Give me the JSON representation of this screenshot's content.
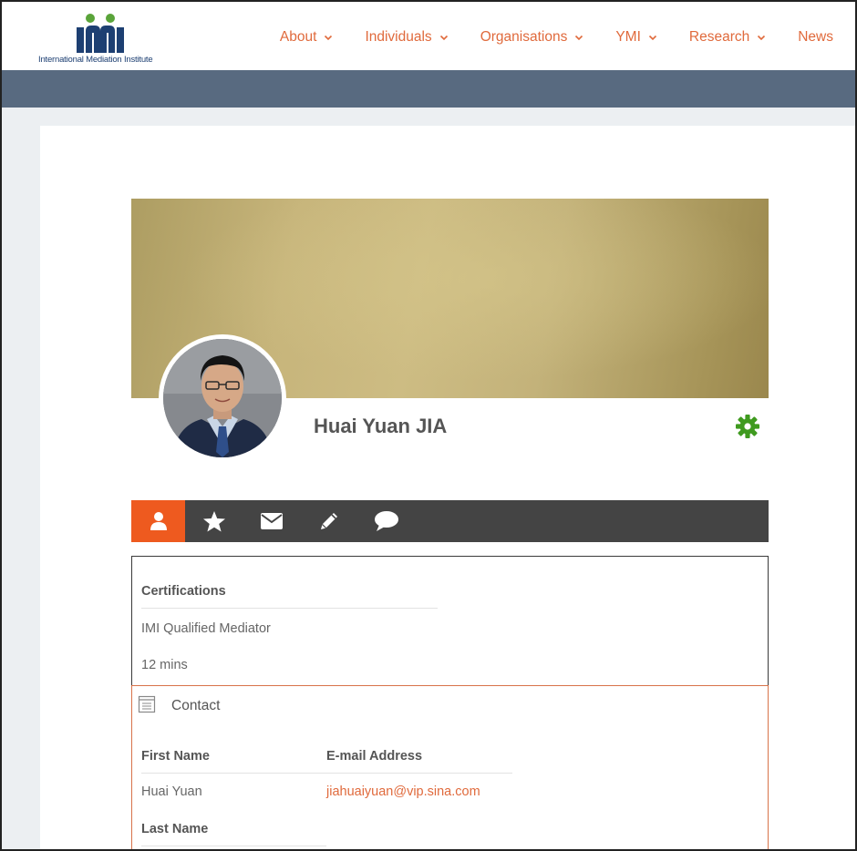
{
  "site": {
    "logo_text": "International Mediation Institute",
    "nav": [
      {
        "label": "About",
        "has_dropdown": true
      },
      {
        "label": "Individuals",
        "has_dropdown": true
      },
      {
        "label": "Organisations",
        "has_dropdown": true
      },
      {
        "label": "YMI",
        "has_dropdown": true
      },
      {
        "label": "Research",
        "has_dropdown": true
      },
      {
        "label": "News",
        "has_dropdown": false
      }
    ]
  },
  "profile": {
    "name": "Huai Yuan JIA",
    "tabs": [
      {
        "icon": "user-icon",
        "active": true
      },
      {
        "icon": "star-icon",
        "active": false
      },
      {
        "icon": "envelope-icon",
        "active": false
      },
      {
        "icon": "pencil-icon",
        "active": false
      },
      {
        "icon": "comment-icon",
        "active": false
      }
    ]
  },
  "certifications": {
    "heading": "Certifications",
    "value": "IMI Qualified Mediator",
    "time": "12 mins"
  },
  "contact": {
    "title": "Contact",
    "first_name_label": "First Name",
    "first_name_value": "Huai Yuan",
    "email_label": "E-mail Address",
    "email_value": "jiahuaiyuan@vip.sina.com",
    "last_name_label": "Last Name"
  },
  "colors": {
    "accent": "#e06a3c",
    "tab_active": "#ee5a1f",
    "tabbar_bg": "#444444",
    "page_bar": "#586a80",
    "gear": "#3f9a1f",
    "logo_blue": "#1d3f72",
    "logo_green": "#5aa43a"
  }
}
